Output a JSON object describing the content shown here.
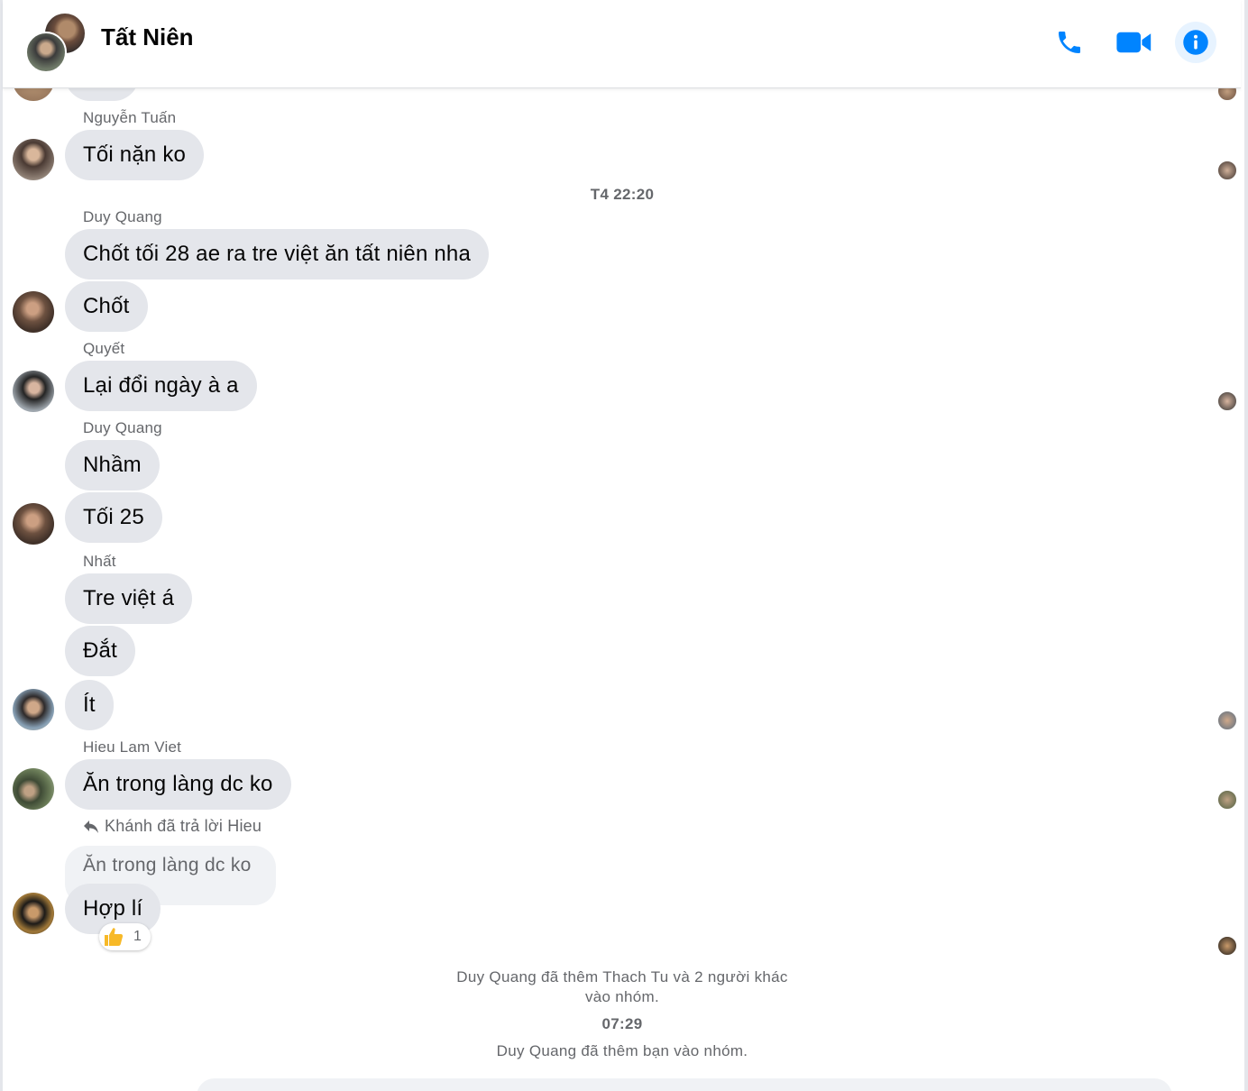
{
  "header": {
    "title": "Tất Niên",
    "icons": [
      "phone-icon",
      "video-camera-icon",
      "info-icon"
    ],
    "accent_color": "#0084ff"
  },
  "messages": {
    "tuan_sender": "Nguyễn Tuấn",
    "tuan_msg": "Tối nặn ko",
    "stamp_1": "T4 22:20",
    "quang_sender": "Duy Quang",
    "quang_msg_1": "Chốt tối 28 ae ra tre việt ăn tất niên nha",
    "quang_msg_2": "Chốt",
    "quyet_sender": "Quyết",
    "quyet_msg": "Lại đổi ngày à a",
    "quang_sender_2": "Duy Quang",
    "quang_msg_3": "Nhầm",
    "quang_msg_4": "Tối 25",
    "nhat_sender": "Nhất",
    "nhat_msg_1": "Tre việt á",
    "nhat_msg_2": "Đắt",
    "nhat_msg_3": "Ít",
    "hieu_sender": "Hieu Lam Viet",
    "hieu_msg": "Ăn trong làng dc ko",
    "reply_indicator": "Khánh đã trả lời Hieu",
    "quoted_text": "Ăn trong làng dc ko",
    "khanh_msg": "Hợp lí",
    "reaction_count": "1",
    "system_1": "Duy Quang đã thêm Thach Tu và 2 người khác vào nhóm.",
    "stamp_2": "07:29",
    "system_2": "Duy Quang đã thêm bạn vào nhóm."
  }
}
